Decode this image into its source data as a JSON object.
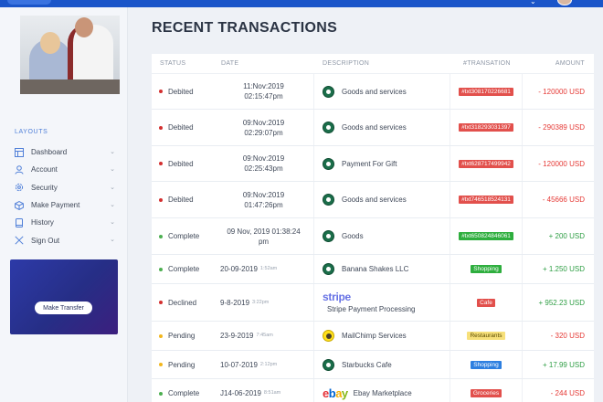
{
  "sidebar": {
    "section_label": "LAYOUTS",
    "items": [
      {
        "label": "Dashboard",
        "icon": "dashboard-icon"
      },
      {
        "label": "Account",
        "icon": "user-icon"
      },
      {
        "label": "Security",
        "icon": "gear-icon"
      },
      {
        "label": "Make Payment",
        "icon": "box-icon"
      },
      {
        "label": "History",
        "icon": "book-icon"
      },
      {
        "label": "Sign Out",
        "icon": "close-icon"
      }
    ],
    "promo": {
      "button_label": "Make Transfer"
    }
  },
  "main": {
    "title": "RECENT TRANSACTIONS",
    "columns": [
      "STATUS",
      "DATE",
      "DESCRIPTION",
      "#TRANSATION",
      "AMOUNT"
    ],
    "rows": [
      {
        "status": "Debited",
        "status_color": "#d32f2f",
        "date": "11:Nov:2019",
        "time": "02:15:47pm",
        "merchant": "starbucks",
        "description": "Goods and services",
        "tag": "#txt308170226681",
        "tag_color": "#e2504c",
        "amount": "- 120000 USD",
        "amount_color": "#e53935"
      },
      {
        "status": "Debited",
        "status_color": "#d32f2f",
        "date": "09:Nov:2019",
        "time": "02:29:07pm",
        "merchant": "starbucks",
        "description": "Goods and services",
        "tag": "#txt318293031397",
        "tag_color": "#e2504c",
        "amount": "- 290389 USD",
        "amount_color": "#e53935"
      },
      {
        "status": "Debited",
        "status_color": "#d32f2f",
        "date": "09:Nov:2019",
        "time": "02:25:43pm",
        "merchant": "starbucks",
        "description": "Payment For Gift",
        "tag": "#txt628717499942",
        "tag_color": "#e2504c",
        "amount": "- 120000 USD",
        "amount_color": "#e53935"
      },
      {
        "status": "Debited",
        "status_color": "#d32f2f",
        "date": "09:Nov:2019",
        "time": "01:47:26pm",
        "merchant": "starbucks",
        "description": "Goods and services",
        "tag": "#txt746518524131",
        "tag_color": "#e2504c",
        "amount": "- 45666 USD",
        "amount_color": "#e53935"
      },
      {
        "status": "Complete",
        "status_color": "#4caf50",
        "date": "09 Nov, 2019 01:38:24",
        "time": "pm",
        "merchant": "starbucks",
        "description": "Goods",
        "tag": "#txt650824846061",
        "tag_color": "#2eae3e",
        "amount": "+ 200 USD",
        "amount_color": "#2e9e44"
      },
      {
        "status": "Complete",
        "status_color": "#4caf50",
        "date": "20-09-2019",
        "time_small": "1:52am",
        "merchant": "starbucks",
        "description": "Banana Shakes LLC",
        "tag": "Shopping",
        "tag_color": "#2eae3e",
        "amount": "+ 1.250 USD",
        "amount_color": "#2e9e44"
      },
      {
        "status": "Declined",
        "status_color": "#d32f2f",
        "date": "9-8-2019",
        "time_small": "3:22pm",
        "merchant": "stripe",
        "merchant_logo_text": "stripe",
        "description": "Stripe Payment Processing",
        "tag": "Cafe",
        "tag_color": "#e2504c",
        "amount": "+ 952.23 USD",
        "amount_color": "#2e9e44"
      },
      {
        "status": "Pending",
        "status_color": "#f2b61c",
        "date": "23-9-2019",
        "time_small": "7:45am",
        "merchant": "mailchimp",
        "description": "MailChimp Services",
        "tag": "Restaurants",
        "tag_color": "#f7e07a",
        "tag_text_color": "#5a4a00",
        "amount": "- 320 USD",
        "amount_color": "#e53935"
      },
      {
        "status": "Pending",
        "status_color": "#f2b61c",
        "date": "10-07-2019",
        "time_small": "2:12pm",
        "merchant": "starbucks",
        "description": "Starbucks Cafe",
        "tag": "Shopping",
        "tag_color": "#2d7fe0",
        "amount": "+ 17.99 USD",
        "amount_color": "#2e9e44"
      },
      {
        "status": "Complete",
        "status_color": "#4caf50",
        "date": "J14-06-2019",
        "time_small": "8:51am",
        "merchant": "ebay",
        "merchant_logo_text": "ebay",
        "description": "Ebay Marketplace",
        "tag": "Groceries",
        "tag_color": "#e2504c",
        "amount": "- 244 USD",
        "amount_color": "#e53935"
      }
    ]
  }
}
